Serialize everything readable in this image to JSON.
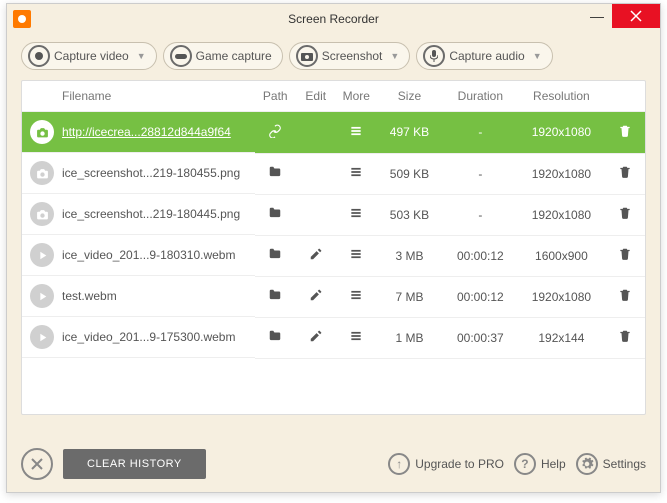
{
  "window": {
    "title": "Screen Recorder"
  },
  "toolbar": {
    "capture_video": "Capture video",
    "game_capture": "Game capture",
    "screenshot": "Screenshot",
    "capture_audio": "Capture audio"
  },
  "table": {
    "headers": {
      "filename": "Filename",
      "path": "Path",
      "edit": "Edit",
      "more": "More",
      "size": "Size",
      "duration": "Duration",
      "resolution": "Resolution"
    },
    "rows": [
      {
        "type": "screenshot",
        "selected": true,
        "filename": "http://icecrea...28812d844a9f64",
        "path_icon": "link",
        "edit": false,
        "size": "497 KB",
        "duration": "-",
        "resolution": "1920x1080"
      },
      {
        "type": "screenshot",
        "selected": false,
        "filename": "ice_screenshot...219-180455.png",
        "path_icon": "folder",
        "edit": false,
        "size": "509 KB",
        "duration": "-",
        "resolution": "1920x1080"
      },
      {
        "type": "screenshot",
        "selected": false,
        "filename": "ice_screenshot...219-180445.png",
        "path_icon": "folder",
        "edit": false,
        "size": "503 KB",
        "duration": "-",
        "resolution": "1920x1080"
      },
      {
        "type": "video",
        "selected": false,
        "filename": "ice_video_201...9-180310.webm",
        "path_icon": "folder",
        "edit": true,
        "size": "3 MB",
        "duration": "00:00:12",
        "resolution": "1600x900"
      },
      {
        "type": "video",
        "selected": false,
        "filename": "test.webm",
        "path_icon": "folder",
        "edit": true,
        "size": "7 MB",
        "duration": "00:00:12",
        "resolution": "1920x1080"
      },
      {
        "type": "video",
        "selected": false,
        "filename": "ice_video_201...9-175300.webm",
        "path_icon": "folder",
        "edit": true,
        "size": "1 MB",
        "duration": "00:00:37",
        "resolution": "192x144"
      }
    ]
  },
  "footer": {
    "clear_history": "CLEAR HISTORY",
    "upgrade": "Upgrade to PRO",
    "help": "Help",
    "settings": "Settings"
  }
}
